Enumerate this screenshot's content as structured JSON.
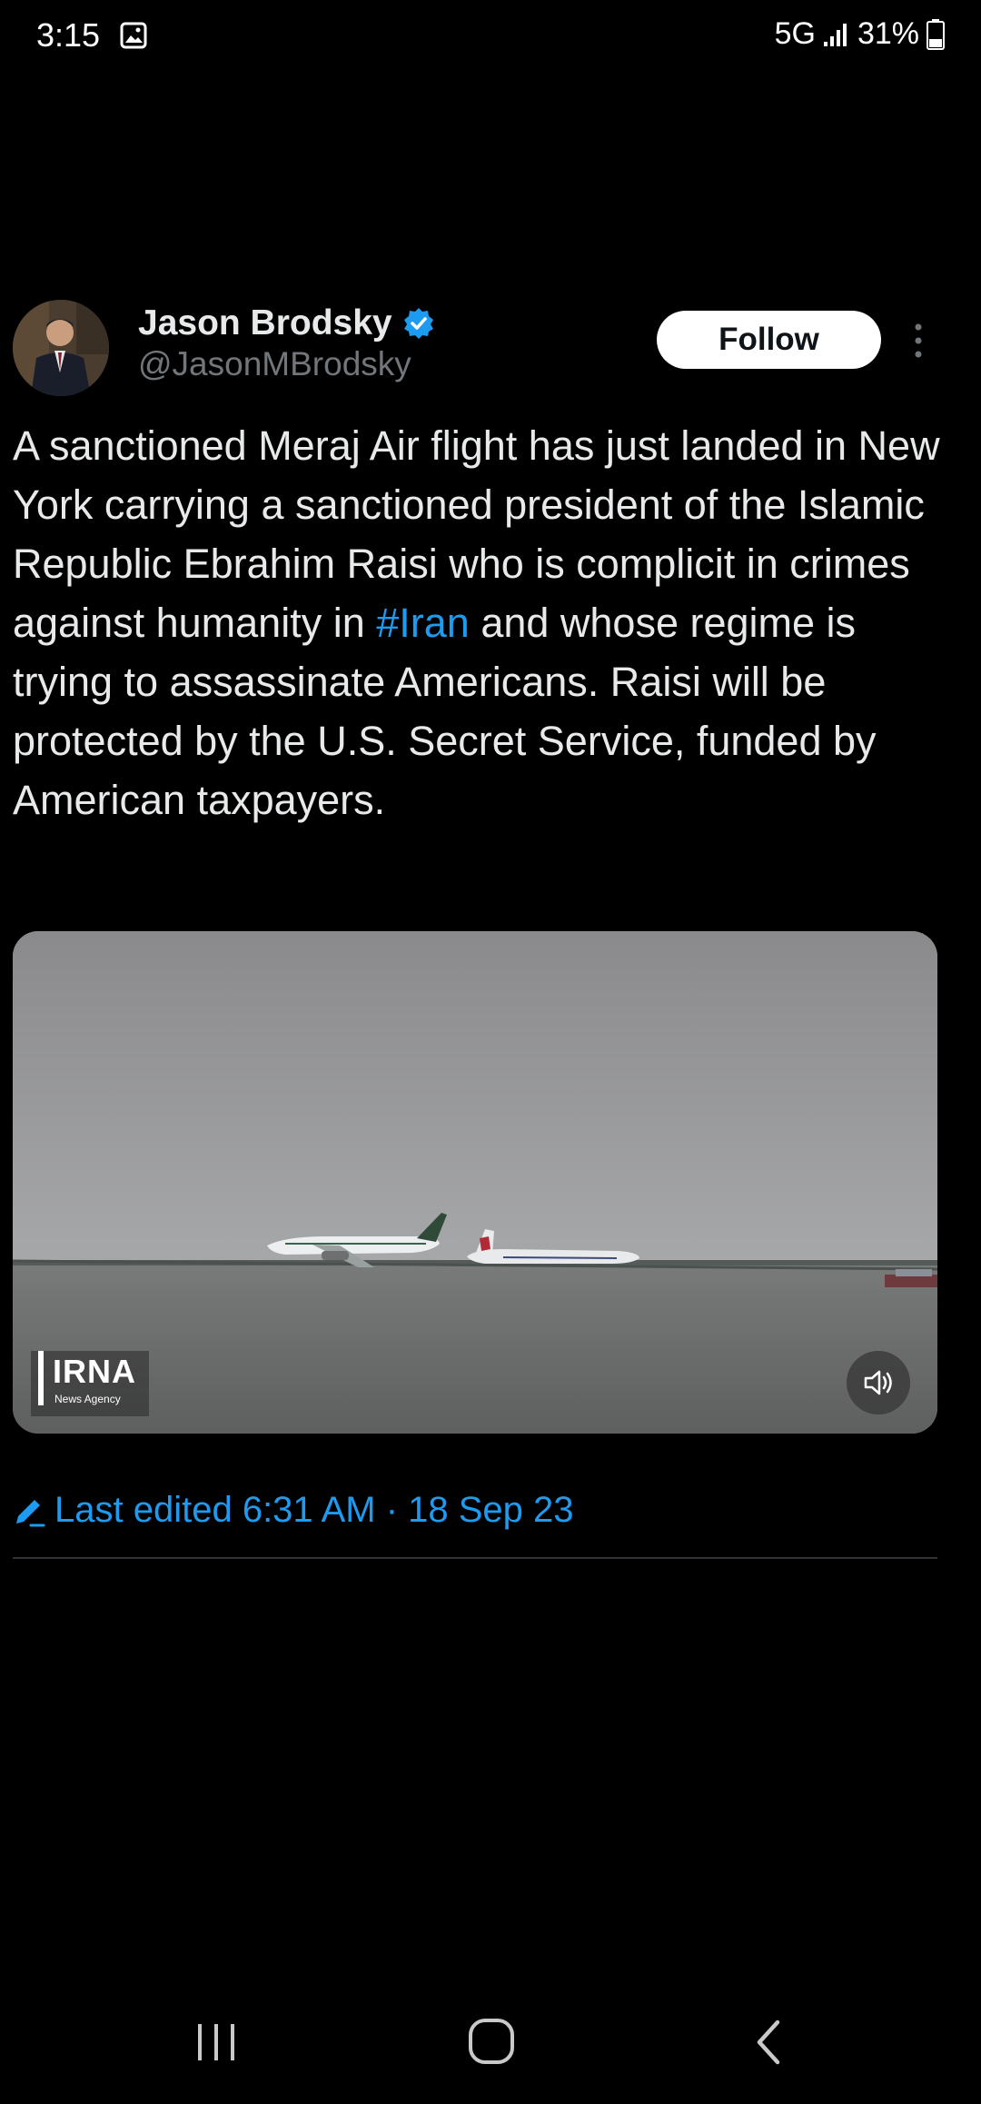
{
  "status_bar": {
    "time": "3:15",
    "network": "5G",
    "battery": "31%"
  },
  "tweet": {
    "author_name": "Jason Brodsky",
    "author_handle": "@JasonMBrodsky",
    "follow_label": "Follow",
    "text_before_hashtag": "A sanctioned Meraj Air flight has just landed in New York carrying a sanctioned president of the Islamic Republic Ebrahim Raisi who is complicit in crimes against humanity in ",
    "hashtag": "#Iran",
    "text_after_hashtag": " and whose regime is trying to assassinate Americans. Raisi will be protected by the U.S. Secret Service, funded by American taxpayers.",
    "media": {
      "watermark": "IRNA",
      "watermark_sub": "News Agency"
    },
    "edited_label": "Last edited 6:31 AM · 18 Sep 23"
  },
  "colors": {
    "background": "#000000",
    "text": "#e7e9ea",
    "secondary_text": "#71767b",
    "link": "#1d9bf0",
    "verified": "#1d9bf0"
  },
  "icons": {
    "status": [
      "gallery-icon",
      "signal-icon",
      "battery-icon"
    ],
    "tweet": [
      "verified-badge-icon",
      "more-options-icon",
      "volume-icon",
      "edit-pencil-icon"
    ],
    "nav": [
      "recent-apps-icon",
      "home-icon",
      "back-icon"
    ]
  }
}
